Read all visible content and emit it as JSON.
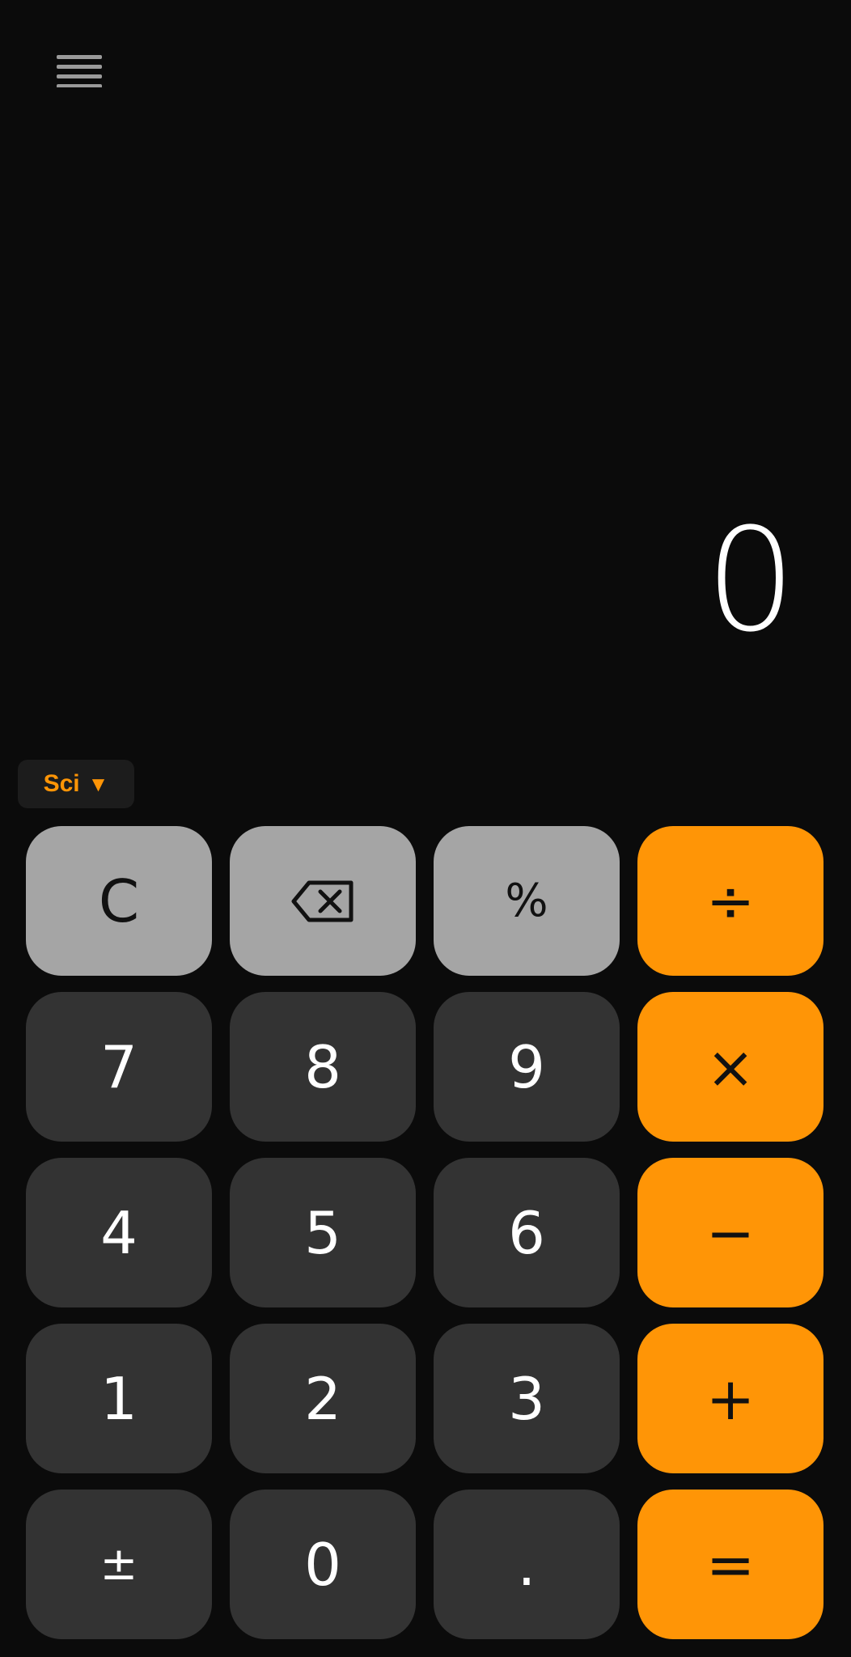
{
  "colors": {
    "background": "#0b0b0b",
    "function_key": "#a5a5a5",
    "number_key": "#333333",
    "operator_key": "#ff9506",
    "sci_toggle_bg": "#1c1c1c",
    "accent": "#ff9506"
  },
  "header": {
    "menu_icon": "hamburger-menu-icon"
  },
  "display": {
    "value": "0"
  },
  "mode_toggle": {
    "label": "Sci",
    "caret": "▼"
  },
  "keys": {
    "clear": "C",
    "backspace_icon": "backspace-icon",
    "percent": "%",
    "divide": "÷",
    "seven": "7",
    "eight": "8",
    "nine": "9",
    "multiply": "×",
    "four": "4",
    "five": "5",
    "six": "6",
    "minus": "−",
    "one": "1",
    "two": "2",
    "three": "3",
    "plus": "+",
    "plus_minus": "±",
    "zero": "0",
    "decimal": ".",
    "equals": "="
  }
}
